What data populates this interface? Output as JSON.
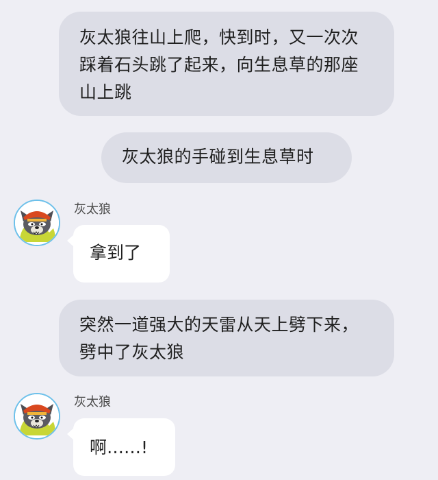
{
  "chat": {
    "narration_1": "灰太狼往山上爬，快到时，又一次次踩着石头跳了起来，向生息草的那座山上跳",
    "narration_2": "灰太狼的手碰到生息草时",
    "narration_3": "突然一道强大的天雷从天上劈下来，劈中了灰太狼",
    "message_1": {
      "speaker": "灰太狼",
      "avatar_icon": "grey-wolf-avatar-icon",
      "text": "拿到了"
    },
    "message_2": {
      "speaker": "灰太狼",
      "avatar_icon": "grey-wolf-avatar-icon",
      "text": "啊……!"
    }
  },
  "colors": {
    "background": "#eeeef4",
    "narration_bubble": "#dcdde6",
    "message_bubble": "#ffffff",
    "avatar_border": "#6cc0ea",
    "wolf_hat": "#d9481f"
  }
}
